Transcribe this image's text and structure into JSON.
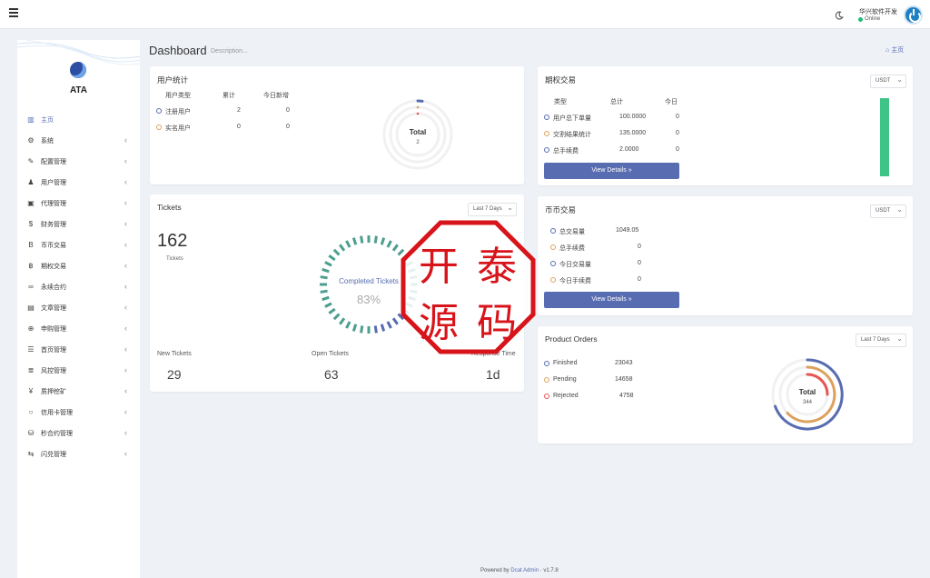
{
  "header": {
    "user_name": "华兴软件开发",
    "user_status": "Online"
  },
  "sidebar": {
    "brand": "ATA",
    "items": [
      {
        "label": "主页",
        "icon": "bar-chart-icon",
        "glyph": "▥",
        "active": true,
        "chevron": false
      },
      {
        "label": "系统",
        "icon": "gear-icon",
        "glyph": "⚙",
        "chevron": true
      },
      {
        "label": "配置管理",
        "icon": "wrench-icon",
        "glyph": "✎",
        "chevron": true
      },
      {
        "label": "用户管理",
        "icon": "users-icon",
        "glyph": "♟",
        "chevron": true
      },
      {
        "label": "代理管理",
        "icon": "id-card-icon",
        "glyph": "▣",
        "chevron": true
      },
      {
        "label": "财务管理",
        "icon": "dollar-icon",
        "glyph": "$",
        "chevron": true
      },
      {
        "label": "币币交易",
        "icon": "bitcoin-icon",
        "glyph": "B",
        "chevron": true
      },
      {
        "label": "期权交易",
        "icon": "bitcoin-small-icon",
        "glyph": "฿",
        "chevron": true
      },
      {
        "label": "永续合约",
        "icon": "link-icon",
        "glyph": "∞",
        "chevron": true
      },
      {
        "label": "文章管理",
        "icon": "newspaper-icon",
        "glyph": "▤",
        "chevron": true
      },
      {
        "label": "申购管理",
        "icon": "globe-icon",
        "glyph": "⊕",
        "chevron": true
      },
      {
        "label": "首页管理",
        "icon": "list-icon",
        "glyph": "☰",
        "chevron": true
      },
      {
        "label": "风控管理",
        "icon": "server-icon",
        "glyph": "≣",
        "chevron": true
      },
      {
        "label": "质押挖矿",
        "icon": "yen-icon",
        "glyph": "¥",
        "chevron": true
      },
      {
        "label": "信用卡管理",
        "icon": "circle-icon",
        "glyph": "○",
        "chevron": true
      },
      {
        "label": "秒合约管理",
        "icon": "coins-icon",
        "glyph": "⛁",
        "chevron": true
      },
      {
        "label": "闪兑管理",
        "icon": "exchange-icon",
        "glyph": "⇆",
        "chevron": true
      }
    ]
  },
  "page": {
    "title": "Dashboard",
    "description": "Description...",
    "home_link": "主页"
  },
  "user_stats": {
    "title": "用户统计",
    "headers": [
      "用户类型",
      "累计",
      "今日新增"
    ],
    "rows": [
      {
        "type": "注册用户",
        "total": "2",
        "today": "0"
      },
      {
        "type": "实名用户",
        "total": "0",
        "today": "0"
      }
    ],
    "ring_label": "Total",
    "ring_value": "2"
  },
  "tickets": {
    "title": "Tickets",
    "range": "Last 7 Days",
    "count": "162",
    "count_label": "Tickets",
    "gauge_label": "Completed Tickets",
    "gauge_value": "83%",
    "gauge_fraction": 0.83,
    "stats": [
      {
        "label": "New Tickets",
        "value": "29"
      },
      {
        "label": "Open Tickets",
        "value": "63"
      },
      {
        "label": "Response Time",
        "value": "1d"
      }
    ]
  },
  "options_trading": {
    "title": "期权交易",
    "currency": "USDT",
    "headers": [
      "类型",
      "总计",
      "今日"
    ],
    "rows": [
      {
        "type": "用户总下单量",
        "total": "100.0000",
        "today": "0"
      },
      {
        "type": "交割结果统计",
        "total": "135.0000",
        "today": "0"
      },
      {
        "type": "总手续费",
        "total": "2.0000",
        "today": "0"
      }
    ],
    "button": "View Details »"
  },
  "coin_trading": {
    "title": "币币交易",
    "currency": "USDT",
    "rows": [
      {
        "type": "总交易量",
        "value": "1049.05"
      },
      {
        "type": "总手续费",
        "value": "0"
      },
      {
        "type": "今日交易量",
        "value": "0"
      },
      {
        "type": "今日手续费",
        "value": "0"
      }
    ],
    "button": "View Details »"
  },
  "product_orders": {
    "title": "Product Orders",
    "range": "Last 7 Days",
    "rows": [
      {
        "label": "Finished",
        "value": "23043"
      },
      {
        "label": "Pending",
        "value": "14658"
      },
      {
        "label": "Rejected",
        "value": "4758"
      }
    ],
    "ring_label": "Total",
    "ring_value": "344"
  },
  "stamp": {
    "chars": [
      "开",
      "泰",
      "源",
      "码"
    ]
  },
  "footer": {
    "powered_by": "Powered by",
    "link": "Dcat Admin",
    "sep": "·",
    "version": "v1.7.8"
  },
  "colors": {
    "primary": "#586cb1",
    "success": "#21b978",
    "warning": "#dda15e",
    "danger": "#ea5455",
    "teal": "#4e9e8e",
    "stamp_red": "#d8141b"
  }
}
